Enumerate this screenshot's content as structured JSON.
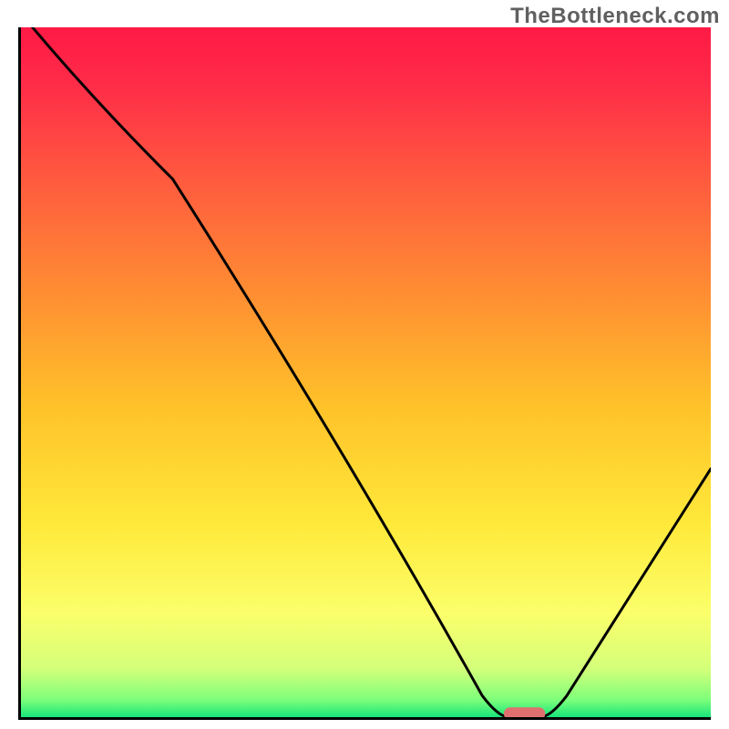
{
  "watermark": "TheBottleneck.com",
  "chart_data": {
    "type": "line",
    "title": "",
    "xlabel": "",
    "ylabel": "",
    "xlim": [
      0,
      100
    ],
    "ylim": [
      0,
      100
    ],
    "x": [
      0,
      22,
      70,
      76,
      100
    ],
    "values": [
      102,
      78,
      0,
      0,
      36
    ],
    "background_gradient": {
      "stops": [
        {
          "offset": 0.0,
          "color": "#ff1a45"
        },
        {
          "offset": 0.08,
          "color": "#ff2b48"
        },
        {
          "offset": 0.22,
          "color": "#ff5a3f"
        },
        {
          "offset": 0.38,
          "color": "#ff8c33"
        },
        {
          "offset": 0.55,
          "color": "#ffc229"
        },
        {
          "offset": 0.72,
          "color": "#ffe93a"
        },
        {
          "offset": 0.85,
          "color": "#fbff6b"
        },
        {
          "offset": 0.93,
          "color": "#d4ff7a"
        },
        {
          "offset": 0.975,
          "color": "#7dff7b"
        },
        {
          "offset": 1.0,
          "color": "#18e47a"
        }
      ]
    },
    "marker": {
      "x_start": 70,
      "x_end": 76,
      "y": 0.5,
      "color": "#e07070",
      "shape": "rounded-bar"
    },
    "series": [
      {
        "name": "bottleneck-curve",
        "x": [
          0,
          22,
          70,
          76,
          100
        ],
        "values": [
          102,
          78,
          0,
          0,
          36
        ]
      }
    ]
  }
}
